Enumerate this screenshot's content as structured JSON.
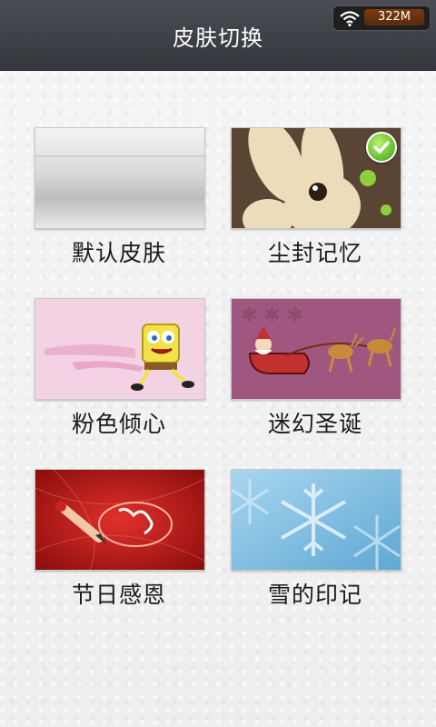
{
  "header": {
    "title": "皮肤切换",
    "status": {
      "memory": "322M",
      "wifi_icon": "wifi-icon"
    }
  },
  "skins": [
    {
      "label": "默认皮肤",
      "selected": false,
      "thumbnail": "gray-gradient"
    },
    {
      "label": "尘封记忆",
      "selected": true,
      "thumbnail": "brown-rabbit"
    },
    {
      "label": "粉色倾心",
      "selected": false,
      "thumbnail": "pink-cartoon"
    },
    {
      "label": "迷幻圣诞",
      "selected": false,
      "thumbnail": "purple-christmas-sleigh"
    },
    {
      "label": "节日感恩",
      "selected": false,
      "thumbnail": "red-festival-pen"
    },
    {
      "label": "雪的印记",
      "selected": false,
      "thumbnail": "blue-snowflake"
    }
  ],
  "colors": {
    "titlebar": "#3b3e44",
    "background": "#f2f2f2",
    "check": "#4caf20"
  }
}
